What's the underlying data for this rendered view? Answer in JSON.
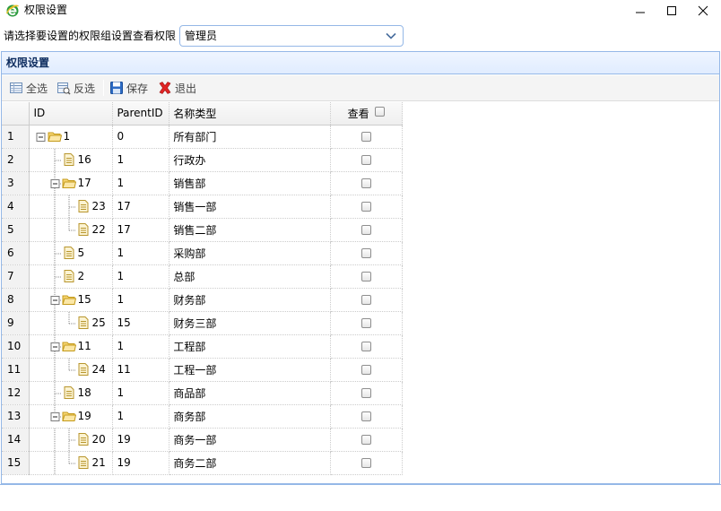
{
  "window": {
    "title": "权限设置"
  },
  "topbar": {
    "prompt": "请选择要设置的权限组设置查看权限",
    "group_value": "管理员"
  },
  "panel": {
    "title": "权限设置"
  },
  "toolbar": {
    "select_all": "全选",
    "invert": "反选",
    "save": "保存",
    "exit": "退出"
  },
  "grid": {
    "headers": {
      "id": "ID",
      "parent": "ParentID",
      "name": "名称类型",
      "view": "查看"
    },
    "rows": [
      {
        "rn": "1",
        "id": "1",
        "parent": "0",
        "name": "所有部门",
        "level": 0,
        "folder": true
      },
      {
        "rn": "2",
        "id": "16",
        "parent": "1",
        "name": "行政办",
        "level": 1,
        "folder": false
      },
      {
        "rn": "3",
        "id": "17",
        "parent": "1",
        "name": "销售部",
        "level": 1,
        "folder": true
      },
      {
        "rn": "4",
        "id": "23",
        "parent": "17",
        "name": "销售一部",
        "level": 2,
        "folder": false
      },
      {
        "rn": "5",
        "id": "22",
        "parent": "17",
        "name": "销售二部",
        "level": 2,
        "folder": false
      },
      {
        "rn": "6",
        "id": "5",
        "parent": "1",
        "name": "采购部",
        "level": 1,
        "folder": false
      },
      {
        "rn": "7",
        "id": "2",
        "parent": "1",
        "name": "总部",
        "level": 1,
        "folder": false
      },
      {
        "rn": "8",
        "id": "15",
        "parent": "1",
        "name": "财务部",
        "level": 1,
        "folder": true
      },
      {
        "rn": "9",
        "id": "25",
        "parent": "15",
        "name": "财务三部",
        "level": 2,
        "folder": false
      },
      {
        "rn": "10",
        "id": "11",
        "parent": "1",
        "name": "工程部",
        "level": 1,
        "folder": true
      },
      {
        "rn": "11",
        "id": "24",
        "parent": "11",
        "name": "工程一部",
        "level": 2,
        "folder": false
      },
      {
        "rn": "12",
        "id": "18",
        "parent": "1",
        "name": "商品部",
        "level": 1,
        "folder": false
      },
      {
        "rn": "13",
        "id": "19",
        "parent": "1",
        "name": "商务部",
        "level": 1,
        "folder": true
      },
      {
        "rn": "14",
        "id": "20",
        "parent": "19",
        "name": "商务一部",
        "level": 2,
        "folder": false
      },
      {
        "rn": "15",
        "id": "21",
        "parent": "19",
        "name": "商务二部",
        "level": 2,
        "folder": false
      }
    ]
  },
  "colors": {
    "border": "#95b8e7",
    "header": "#e0ecff",
    "title": "#0e2d5f"
  },
  "icons": {
    "app": "ie-icon",
    "folder": "folder-icon",
    "file": "file-icon",
    "collapse": "minus-box-icon"
  }
}
